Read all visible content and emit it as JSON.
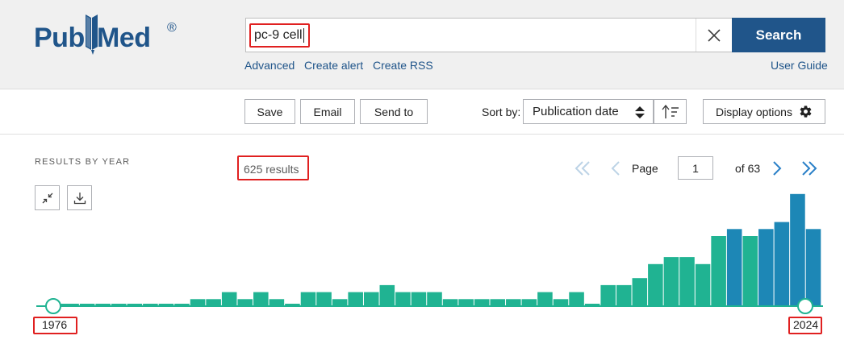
{
  "brand": {
    "logo_part1": "Pub",
    "logo_part2": "Med",
    "registered": "®"
  },
  "search": {
    "query": "pc-9 cell",
    "button_label": "Search",
    "clear_icon": "close-icon"
  },
  "links": {
    "advanced": "Advanced",
    "create_alert": "Create alert",
    "create_rss": "Create RSS",
    "user_guide": "User Guide"
  },
  "toolbar": {
    "save": "Save",
    "email": "Email",
    "send_to": "Send to",
    "sort_by_label": "Sort by:",
    "sort_value": "Publication date",
    "sort_order_icon": "sort-order-icon",
    "display_options": "Display options",
    "display_icon": "gear-icon"
  },
  "results": {
    "by_year_heading": "RESULTS BY YEAR",
    "count_text": "625 results",
    "collapse_icon": "collapse-icon",
    "download_icon": "download-icon"
  },
  "pagination": {
    "page_label": "Page",
    "current_page": "1",
    "of_pages": "of 63"
  },
  "timeline": {
    "start_year": "1976",
    "end_year": "2024"
  },
  "colors": {
    "brand_blue": "#20558a",
    "bar_green": "#20b392",
    "bar_blue": "#1d87b6",
    "highlight_red": "#e02020"
  },
  "chart_data": {
    "type": "bar",
    "x": [
      1976,
      1977,
      1978,
      1979,
      1980,
      1981,
      1982,
      1983,
      1984,
      1985,
      1986,
      1987,
      1988,
      1989,
      1990,
      1991,
      1992,
      1993,
      1994,
      1995,
      1996,
      1997,
      1998,
      1999,
      2000,
      2001,
      2002,
      2003,
      2004,
      2005,
      2006,
      2007,
      2008,
      2009,
      2010,
      2011,
      2012,
      2013,
      2014,
      2015,
      2016,
      2017,
      2018,
      2019,
      2020,
      2021,
      2022,
      2023,
      2024
    ],
    "values": [
      0,
      0,
      0,
      0,
      0,
      0,
      0,
      0,
      0,
      1,
      1,
      2,
      1,
      2,
      1,
      0,
      2,
      2,
      1,
      2,
      2,
      3,
      2,
      2,
      2,
      1,
      1,
      1,
      1,
      1,
      1,
      2,
      1,
      2,
      0,
      3,
      3,
      4,
      6,
      7,
      7,
      6,
      10,
      11,
      10,
      11,
      12,
      16,
      11
    ],
    "xlim": [
      1976,
      2024
    ],
    "start_label": "1976",
    "end_label": "2024"
  }
}
